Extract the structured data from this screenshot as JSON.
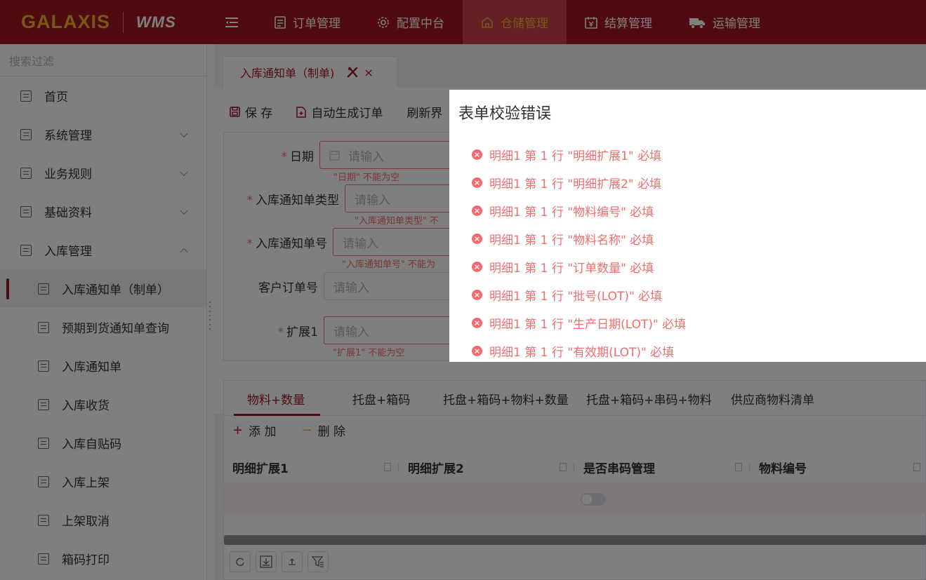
{
  "header": {
    "brand_name": "GALAXIS",
    "brand_sub": "WMS",
    "nav": [
      {
        "label": "订单管理",
        "icon": "document-icon"
      },
      {
        "label": "配置中台",
        "icon": "gear-icon"
      },
      {
        "label": "仓储管理",
        "icon": "home-icon",
        "active": true
      },
      {
        "label": "结算管理",
        "icon": "calendar-yen-icon"
      },
      {
        "label": "运输管理",
        "icon": "truck-icon"
      }
    ],
    "colors": {
      "bar": "#a11623",
      "active_bg": "#c9404a",
      "brand": "#e8b22e"
    }
  },
  "sidebar": {
    "search_placeholder": "搜索过滤",
    "items": [
      {
        "label": "首页"
      },
      {
        "label": "系统管理"
      },
      {
        "label": "业务规则"
      },
      {
        "label": "基础资料"
      },
      {
        "label": "入库管理"
      },
      {
        "label": "入库通知单（制单）"
      },
      {
        "label": "预期到货通知单查询"
      },
      {
        "label": "入库通知单"
      },
      {
        "label": "入库收货"
      },
      {
        "label": "入库自贴码"
      },
      {
        "label": "入库上架"
      },
      {
        "label": "上架取消"
      },
      {
        "label": "箱码打印"
      }
    ]
  },
  "tab": {
    "label": "入库通知单（制单)",
    "close": "×"
  },
  "toolbar": {
    "save": "保 存",
    "auto": "自动生成订单",
    "refresh": "刷新界"
  },
  "form": {
    "date_label": "日期",
    "date_placeholder": "请输入",
    "date_error": "\"日期\" 不能为空",
    "type_label": "入库通知单类型",
    "type_placeholder": "请输入",
    "type_error": "\"入库通知单类型\" 不",
    "no_label": "入库通知单号",
    "no_placeholder": "请输入",
    "no_error": "\"入库通知单号\" 不能为",
    "cust_label": "客户订单号",
    "cust_placeholder": "请输入",
    "ext_label": "扩展1",
    "ext_placeholder": "请输入",
    "ext_error": "\"扩展1\" 不能为空",
    "required_mark": "*"
  },
  "detail": {
    "tabs": [
      "物料+数量",
      "托盘+箱码",
      "托盘+箱码+物料+数量",
      "托盘+箱码+串码+物料",
      "供应商物料清单"
    ],
    "add": "添 加",
    "delete": "删 除",
    "add_symbol": "+",
    "delete_symbol": "−",
    "columns": [
      "明细扩展1",
      "明细扩展2",
      "是否串码管理",
      "物料编号"
    ]
  },
  "dialog": {
    "title": "表单校验错误",
    "errors": [
      "明细1 第 1 行 \"明细扩展1\" 必填",
      "明细1 第 1 行 \"明细扩展2\" 必填",
      "明细1 第 1 行 \"物料编号\" 必填",
      "明细1 第 1 行 \"物料名称\" 必填",
      "明细1 第 1 行 \"订单数量\" 必填",
      "明细1 第 1 行 \"批号(LOT)\" 必填",
      "明细1 第 1 行 \"生产日期(LOT)\" 必填",
      "明细1 第 1 行 \"有效期(LOT)\" 必填"
    ],
    "error_color": "#f56c6c"
  }
}
